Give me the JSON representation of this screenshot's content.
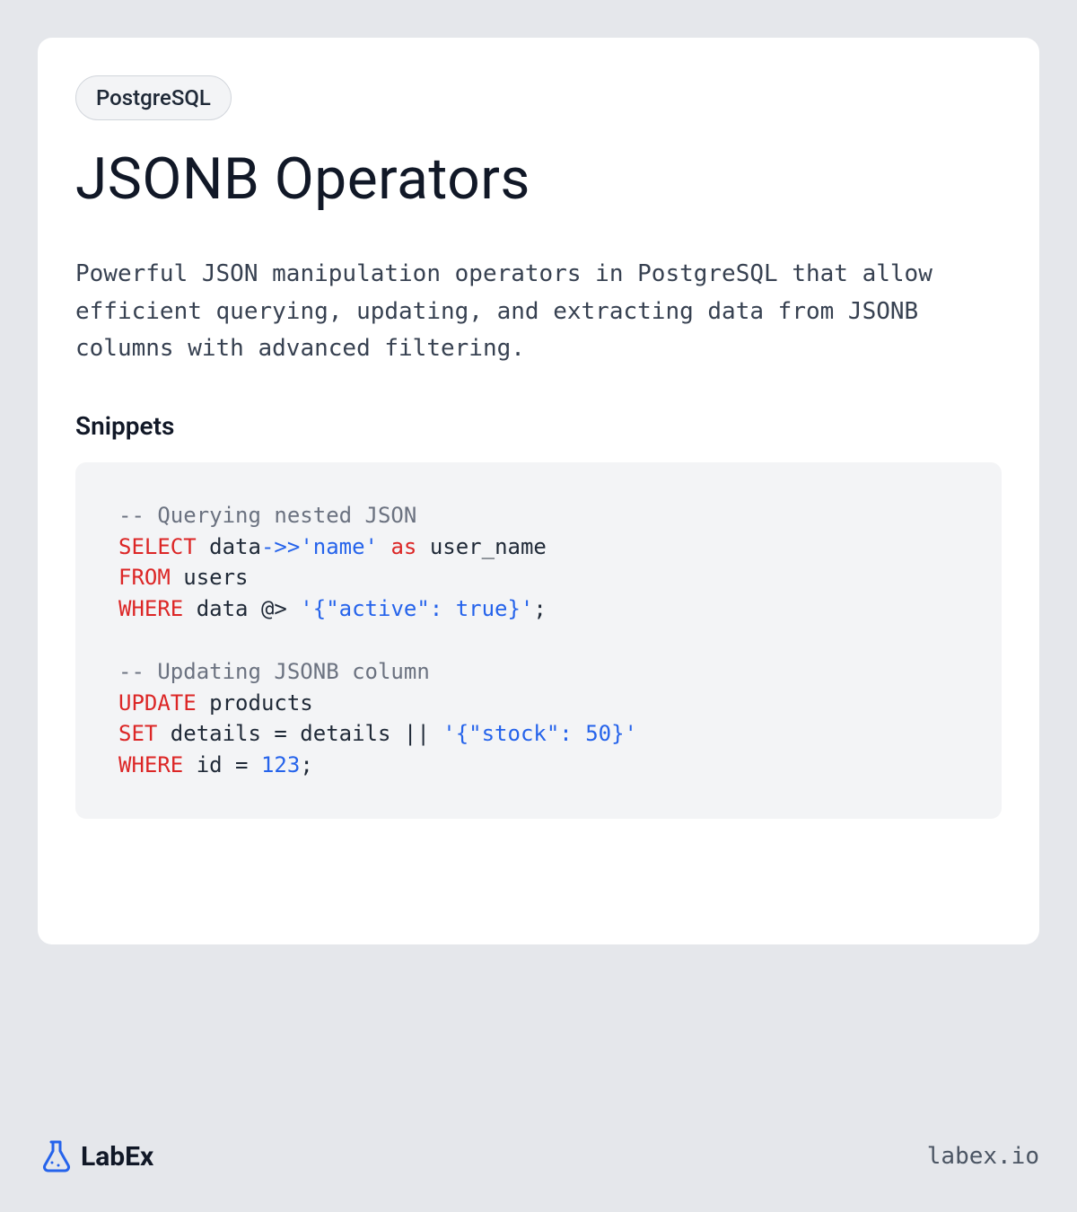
{
  "badge": "PostgreSQL",
  "title": "JSONB Operators",
  "description": "Powerful JSON manipulation operators in PostgreSQL that allow efficient querying, updating, and extracting data from JSONB columns with advanced filtering.",
  "subheading": "Snippets",
  "code": {
    "comment1": "-- Querying nested JSON",
    "kw_select": "SELECT",
    "l1_a": " data",
    "op_arrow": "->>",
    "str_name": "'name'",
    "kw_as": "as",
    "l1_b": " user_name",
    "kw_from": "FROM",
    "l2_a": " users",
    "kw_where1": "WHERE",
    "l3_a": " data @> ",
    "str_active": "'{\"active\": true}'",
    "l3_b": ";",
    "comment2": "-- Updating JSONB column",
    "kw_update": "UPDATE",
    "l4_a": " products",
    "kw_set": "SET",
    "l5_a": " details = details || ",
    "str_stock": "'{\"stock\": 50}'",
    "kw_where2": "WHERE",
    "l6_a": " id = ",
    "num_123": "123",
    "l6_b": ";"
  },
  "footer": {
    "brand": "LabEx",
    "url": "labex.io"
  }
}
